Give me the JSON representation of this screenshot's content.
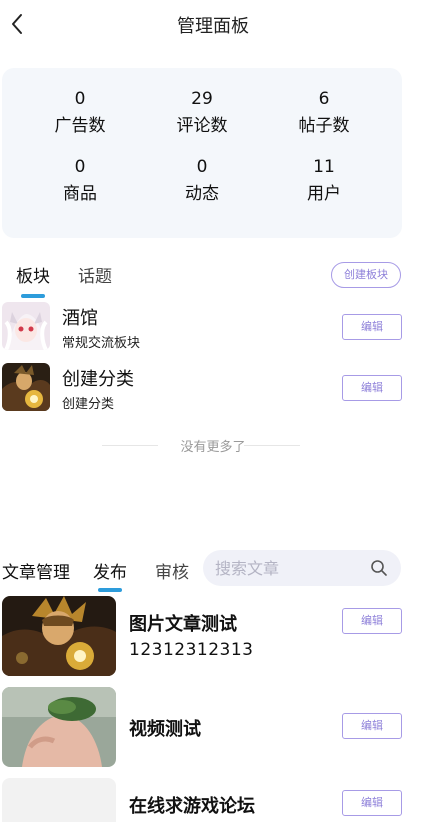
{
  "header": {
    "title": "管理面板"
  },
  "stats": [
    {
      "value": "0",
      "label": "广告数"
    },
    {
      "value": "29",
      "label": "评论数"
    },
    {
      "value": "6",
      "label": "帖子数"
    },
    {
      "value": "0",
      "label": "商品"
    },
    {
      "value": "0",
      "label": "动态"
    },
    {
      "value": "11",
      "label": "用户"
    }
  ],
  "section_tabs": [
    {
      "label": "板块",
      "active": true
    },
    {
      "label": "话题",
      "active": false
    }
  ],
  "create_board_label": "创建板块",
  "boards": [
    {
      "name": "酒馆",
      "desc": "常规交流板块",
      "edit_label": "编辑"
    },
    {
      "name": "创建分类",
      "desc": "创建分类",
      "edit_label": "编辑"
    }
  ],
  "no_more_text": "没有更多了",
  "article_tabs": {
    "heading": "文章管理",
    "tabs": [
      {
        "label": "发布",
        "active": true
      },
      {
        "label": "审核",
        "active": false
      }
    ]
  },
  "search": {
    "placeholder": "搜索文章"
  },
  "articles": [
    {
      "title": "图片文章测试",
      "subtitle": "12312312313",
      "edit_label": "编辑"
    },
    {
      "title": "视频测试",
      "subtitle": "",
      "edit_label": "编辑"
    },
    {
      "title": "在线求游戏论坛",
      "subtitle": "",
      "edit_label": "编辑"
    }
  ],
  "colors": {
    "accent": "#2d9cdb",
    "button_border": "#a79be6",
    "button_text": "#8d7fd9",
    "card_bg": "#f4f7fb"
  }
}
